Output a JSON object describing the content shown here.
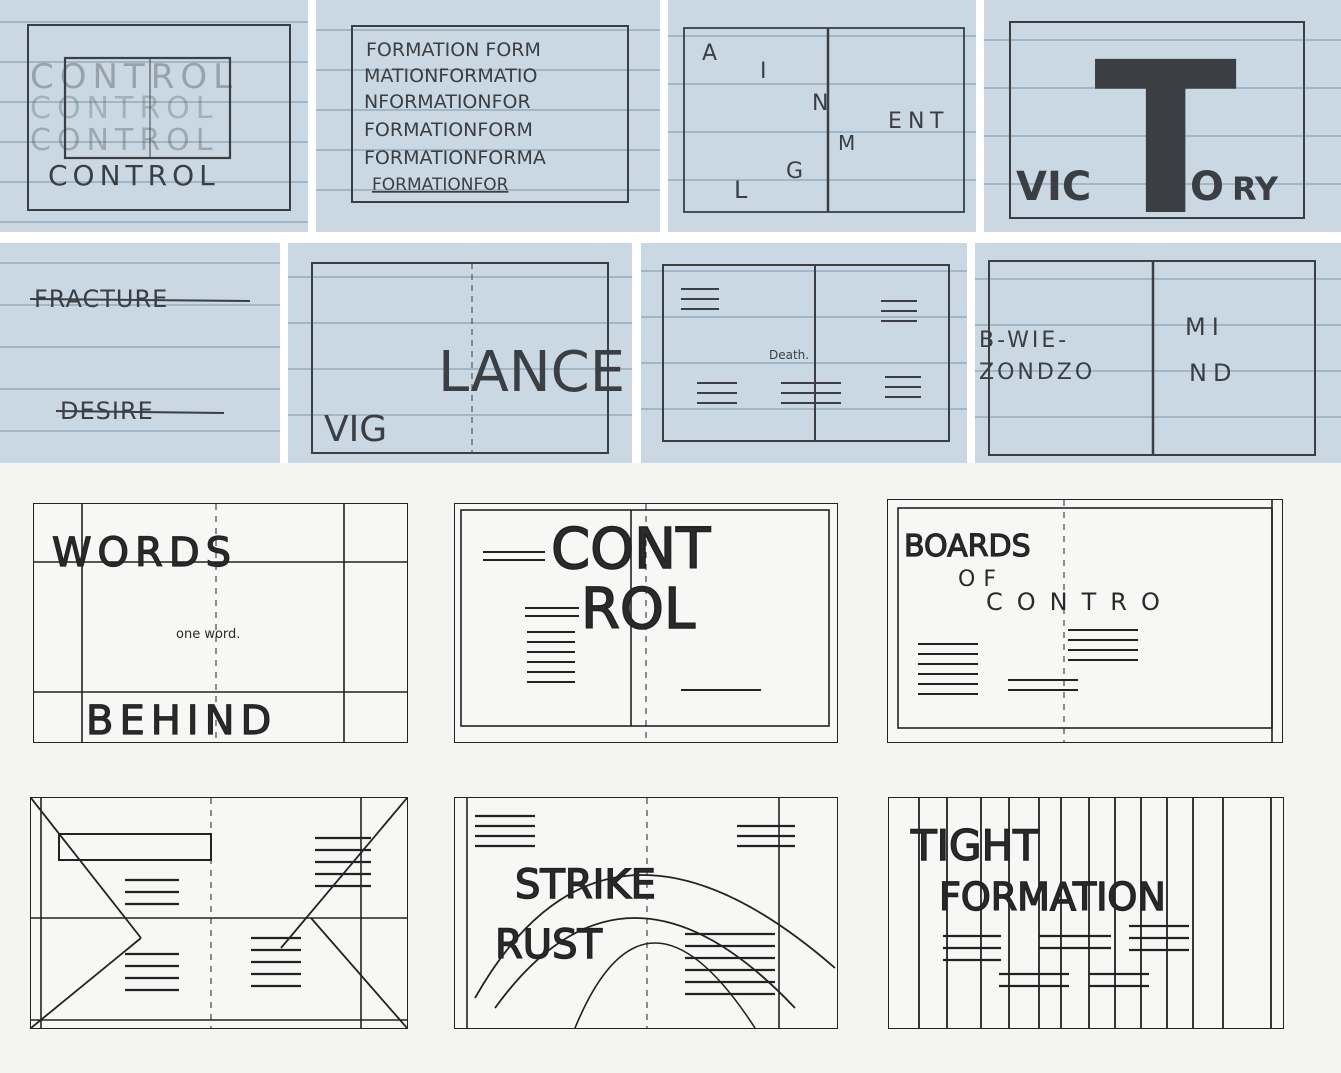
{
  "thumbnails": [
    {
      "id": "control",
      "lines": [
        "CONTROL",
        "CONTROL",
        "CONTROL",
        "CONTROL"
      ]
    },
    {
      "id": "formation",
      "lines": [
        "FORMATION FORM",
        "MATIONFORMATIO",
        "NFORMATIONFOR",
        "FORMATIONFORM",
        "FORMATIONFORMA",
        "FORMATIONFOR"
      ]
    },
    {
      "id": "alignment",
      "letters": [
        "A",
        "I",
        "N",
        "E",
        "N",
        "T",
        "M",
        "G",
        "L"
      ]
    },
    {
      "id": "victory",
      "big": "T",
      "word_left": "VIC",
      "word_o": "O",
      "word_right": "RY"
    },
    {
      "id": "fracture",
      "word1": "FRACTURE",
      "word2": "DESIRE"
    },
    {
      "id": "vigilance",
      "small": "VIG",
      "big": "LANCE"
    },
    {
      "id": "death",
      "center": "Death."
    },
    {
      "id": "mind",
      "left1": "B-WIE-",
      "left2": "ZONDZO",
      "right1": "MI",
      "right2": "ND"
    }
  ],
  "sketches": [
    {
      "id": "words",
      "top": "WORDS",
      "center": "one word.",
      "bottom": "BEHIND"
    },
    {
      "id": "control-big",
      "line1": "CONT",
      "line2": "ROL"
    },
    {
      "id": "boards",
      "line1": "BOARDS",
      "line2": "OF",
      "line3": "CONTRO"
    },
    {
      "id": "cross"
    },
    {
      "id": "strike",
      "word1": "STRIKE",
      "word2": "RUST"
    },
    {
      "id": "tight",
      "line1": "TIGHT",
      "line2": "FORMATION"
    }
  ],
  "colors": {
    "paper_blue": "#c9d8e2",
    "rule": "#8aa2b4",
    "pencil": "#3b3f44",
    "ink": "#222222"
  }
}
